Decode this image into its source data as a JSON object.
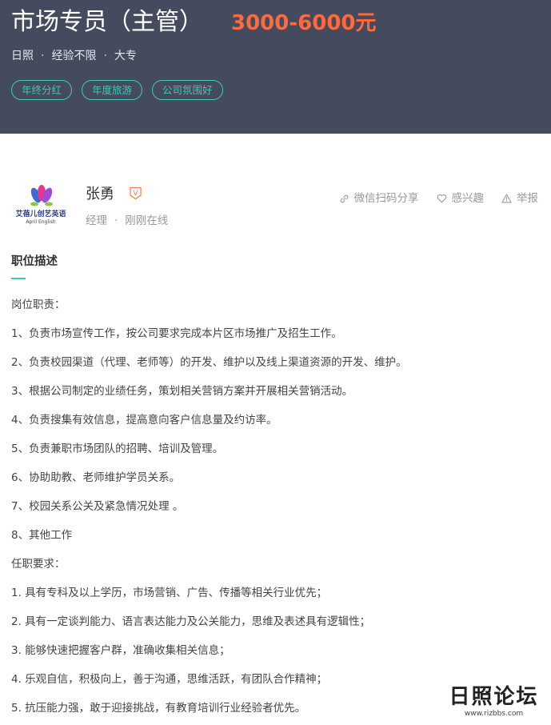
{
  "job": {
    "title": "市场专员（主管）",
    "salary": "3000-6000元",
    "location": "日照",
    "experience": "经验不限",
    "education": "大专",
    "separator": "·",
    "tags": [
      "年终分红",
      "年度旅游",
      "公司氛围好"
    ]
  },
  "company": {
    "logo_text": "艾蓓儿创艺英语",
    "logo_subtext": "April English"
  },
  "hr": {
    "name": "张勇",
    "badge": "V",
    "title": "经理",
    "status": "刚刚在线"
  },
  "actions": {
    "share": "微信扫码分享",
    "interest": "感兴趣",
    "report": "举报"
  },
  "description": {
    "heading": "职位描述",
    "lines": [
      "岗位职责：",
      "1、负责市场宣传工作，按公司要求完成本片区市场推广及招生工作。",
      "2、负责校园渠道（代理、老师等）的开发、维护以及线上渠道资源的开发、维护。",
      "3、根据公司制定的业绩任务，策划相关营销方案并开展相关营销活动。",
      "4、负责搜集有效信息，提高意向客户信息量及约访率。",
      "5、负责兼职市场团队的招聘、培训及管理。",
      "6、协助助教、老师维护学员关系。",
      "7、校园关系公关及紧急情况处理 。",
      "8、其他工作",
      "任职要求：",
      "1. 具有专科及以上学历，市场营销、广告、传播等相关行业优先；",
      "2. 具有一定谈判能力、语言表达能力及公关能力，思维及表述具有逻辑性；",
      "3. 能够快速把握客户群，准确收集相关信息；",
      "4. 乐观自信，积极向上，善于沟通，思维活跃，有团队合作精神；",
      "5. 抗压能力强，敢于迎接挑战，有教育培训行业经验者优先。"
    ]
  },
  "watermark": {
    "title": "日照论坛",
    "url": "www.rizbbs.com"
  },
  "colors": {
    "header_bg": "#444b5e",
    "salary": "#ff6a3d",
    "accent": "#43c7b5",
    "badge": "#ff7a45"
  },
  "icons": [
    "link-icon",
    "heart-icon",
    "warning-icon",
    "verified-badge-icon"
  ]
}
